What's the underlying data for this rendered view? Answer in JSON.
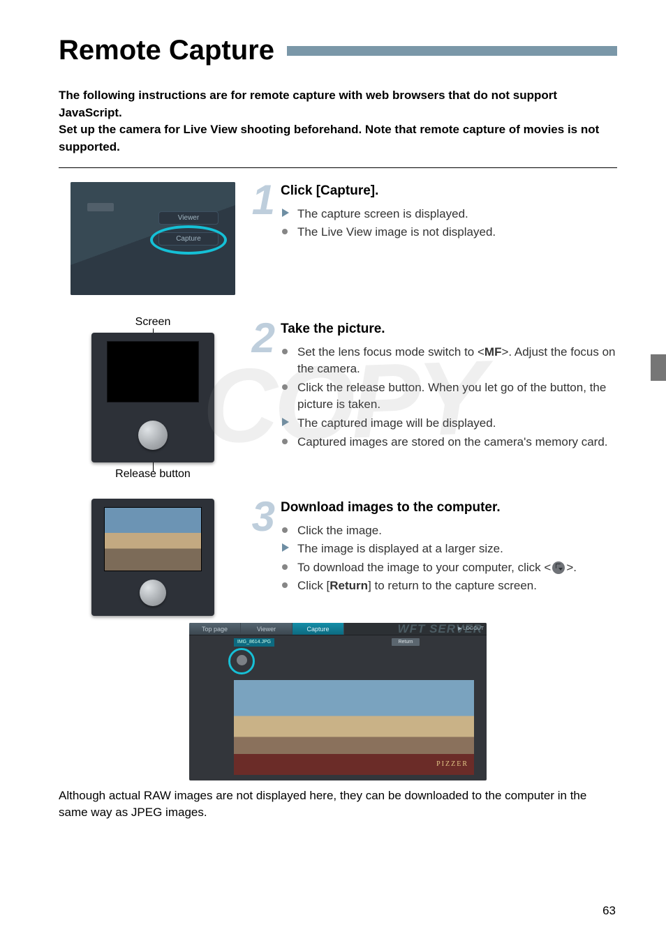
{
  "page_title": "Remote Capture",
  "page_number": "63",
  "intro_line1": "The following instructions are for remote capture with web browsers that do not support JavaScript.",
  "intro_line2": "Set up the camera for Live View shooting beforehand. Note that remote capture of movies is not supported.",
  "step1": {
    "num": "1",
    "title": "Click [Capture].",
    "bullets": [
      {
        "icon": "tri",
        "text": "The capture screen is displayed."
      },
      {
        "icon": "dot",
        "text": "The Live View image is not displayed."
      }
    ],
    "menu_viewer": "Viewer",
    "menu_capture": "Capture"
  },
  "step2": {
    "num": "2",
    "title": "Take the picture.",
    "label_screen": "Screen",
    "label_release": "Release button",
    "bullets": [
      {
        "icon": "dot",
        "html": "Set the lens focus mode switch to <<span class=\"mf-badge\">MF</span>>. Adjust the focus on the camera."
      },
      {
        "icon": "dot",
        "text": "Click the release button. When you let go of the button, the picture is taken."
      },
      {
        "icon": "tri",
        "text": "The captured image will be displayed."
      },
      {
        "icon": "dot",
        "text": "Captured images are stored on the camera's memory card."
      }
    ]
  },
  "step3": {
    "num": "3",
    "title": "Download images to the computer.",
    "bullets": [
      {
        "icon": "dot",
        "text": "Click the image."
      },
      {
        "icon": "tri",
        "text": "The image is displayed at a larger size."
      },
      {
        "icon": "dot",
        "html": "To download the image to your computer, click <<span class=\"icon-download\" data-name=\"download-icon\" data-interactable=\"false\"></span>>."
      },
      {
        "icon": "dot",
        "html": "Click [<b>Return</b>] to return to the capture screen."
      }
    ]
  },
  "wft": {
    "tab_top": "Top page",
    "tab_viewer": "Viewer",
    "tab_capture": "Capture",
    "logo": "WFT SERVER",
    "logout": "▶ LOGOUT",
    "filename": "IMG_8614.JPG",
    "return": "Return"
  },
  "footnote": "Although actual RAW images are not displayed here, they can be downloaded to the computer in the same way as JPEG images.",
  "watermark": "COPY"
}
